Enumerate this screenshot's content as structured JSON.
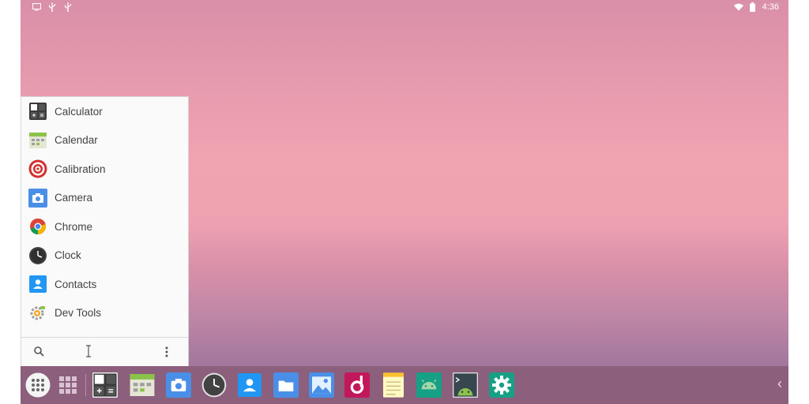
{
  "statusbar": {
    "left_icons": [
      "screen-icon",
      "usb-icon",
      "usb-icon"
    ],
    "wifi_icon": "wifi-icon",
    "battery_icon": "battery-icon",
    "time": "4:36"
  },
  "launcher": {
    "apps": [
      {
        "label": "Calculator",
        "icon": "calculator-icon"
      },
      {
        "label": "Calendar",
        "icon": "calendar-icon"
      },
      {
        "label": "Calibration",
        "icon": "calibration-icon"
      },
      {
        "label": "Camera",
        "icon": "camera-icon"
      },
      {
        "label": "Chrome",
        "icon": "chrome-icon"
      },
      {
        "label": "Clock",
        "icon": "clock-icon"
      },
      {
        "label": "Contacts",
        "icon": "contacts-icon"
      },
      {
        "label": "Dev Tools",
        "icon": "dev-tools-icon"
      }
    ],
    "search_icon": "search-icon",
    "menu_icon": "more-vert-icon"
  },
  "taskbar": {
    "items": [
      "app-drawer-icon",
      "grid-icon",
      "calculator-icon",
      "calendar-icon",
      "camera-icon",
      "clock-icon",
      "contacts-icon",
      "files-icon",
      "gallery-icon",
      "music-icon",
      "notes-icon",
      "android-app-icon",
      "terminal-icon",
      "settings-icon"
    ],
    "back_chevron": "‹"
  },
  "colors": {
    "taskbar_bg": "#8c5f7c",
    "launcher_bg": "#fafafa",
    "accent_blue": "#4a8fe7",
    "accent_teal": "#16a085"
  }
}
